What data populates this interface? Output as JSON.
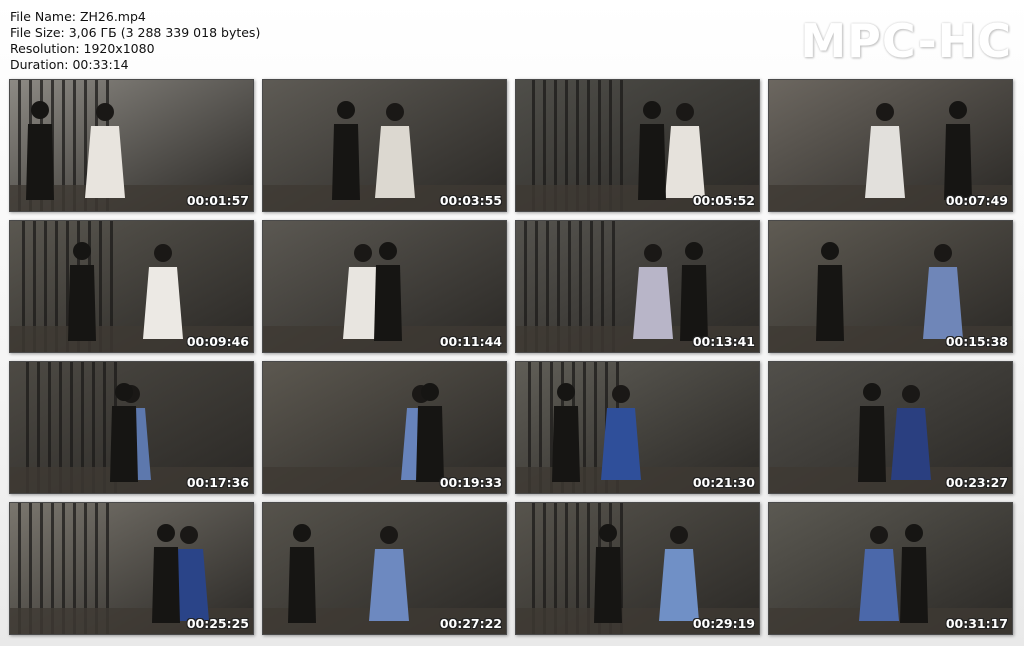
{
  "file_info": {
    "name_line": "File Name: ZH26.mp4",
    "size_line": "File Size: 3,06 ГБ (3 288 339 018 bytes)",
    "resolution_line": "Resolution: 1920x1080",
    "duration_line": "Duration: 00:33:14"
  },
  "logo_text": "MPC-HC",
  "thumbnails": [
    {
      "timestamp": "00:01:57",
      "bg": "#8d8a84",
      "accent": "#e8e4de"
    },
    {
      "timestamp": "00:03:55",
      "bg": "#5e5b55",
      "accent": "#dcd8d0"
    },
    {
      "timestamp": "00:05:52",
      "bg": "#4f4e49",
      "accent": "#e6e2dc"
    },
    {
      "timestamp": "00:07:49",
      "bg": "#6c6760",
      "accent": "#e2e0dc"
    },
    {
      "timestamp": "00:09:46",
      "bg": "#5a5750",
      "accent": "#ece9e4"
    },
    {
      "timestamp": "00:11:44",
      "bg": "#5b5852",
      "accent": "#e8e5e0"
    },
    {
      "timestamp": "00:13:41",
      "bg": "#55534e",
      "accent": "#b8b5c8"
    },
    {
      "timestamp": "00:15:38",
      "bg": "#5f5b53",
      "accent": "#6f86b8"
    },
    {
      "timestamp": "00:17:36",
      "bg": "#4d4a44",
      "accent": "#5d78ad"
    },
    {
      "timestamp": "00:19:33",
      "bg": "#5c5850",
      "accent": "#6783bb"
    },
    {
      "timestamp": "00:21:30",
      "bg": "#605e57",
      "accent": "#2f4f9a"
    },
    {
      "timestamp": "00:23:27",
      "bg": "#514f4a",
      "accent": "#2a3f80"
    },
    {
      "timestamp": "00:25:25",
      "bg": "#7a766e",
      "accent": "#2a4488"
    },
    {
      "timestamp": "00:27:22",
      "bg": "#56534c",
      "accent": "#6d89c0"
    },
    {
      "timestamp": "00:29:19",
      "bg": "#57544d",
      "accent": "#7090c6"
    },
    {
      "timestamp": "00:31:17",
      "bg": "#5b5952",
      "accent": "#4b68aa"
    }
  ]
}
